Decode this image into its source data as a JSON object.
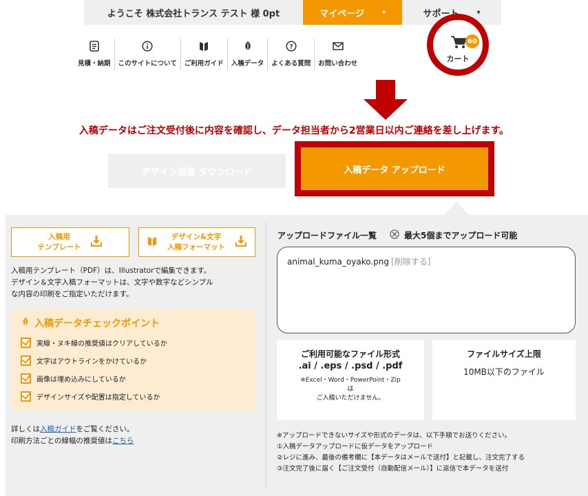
{
  "topbar": {
    "welcome": "ようこそ 株式会社トランス テスト 様 0pt",
    "mypage": "マイページ",
    "support": "サポート"
  },
  "nav": [
    {
      "label": "見積・納期",
      "icon": "document-icon"
    },
    {
      "label": "このサイトについて",
      "icon": "info-icon"
    },
    {
      "label": "ご利用ガイド",
      "icon": "book-icon"
    },
    {
      "label": "入稿データ",
      "icon": "leaf-icon"
    },
    {
      "label": "よくある質問",
      "icon": "question-icon"
    },
    {
      "label": "お問い合わせ",
      "icon": "mail-icon"
    }
  ],
  "cart": {
    "label": "カート",
    "count": "60"
  },
  "notice": "入稿データはご注文受付後に内容を確認し、データ担当者から2営業日以内ご連絡を差し上げます。",
  "buttons": {
    "download": "デザイン画像 ダウンロード",
    "upload": "入稿データ アップロード"
  },
  "left": {
    "template_btn_line1": "入稿用",
    "template_btn_line2": "テンプレート",
    "format_btn_line1": "デザイン&文字",
    "format_btn_line2": "入稿フォーマット",
    "desc_line1": "入稿用テンプレート（PDF）は、Illustratorで編集できます。",
    "desc_line2": "デザイン＆文字入稿フォーマットは、文字や数字などシンプル",
    "desc_line3": "な内容の印刷をご指定いただけます。",
    "check_title": "入稿データチェックポイント",
    "checks": [
      "実線・ヌキ線の推奨値はクリアしているか",
      "文字はアウトラインをかけているか",
      "画像は埋め込みにしているか",
      "デザインサイズや配置は指定しているか"
    ],
    "foot1_pre": "詳しくは",
    "foot1_link": "入稿ガイド",
    "foot1_post": "をご覧ください。",
    "foot2_pre": "印刷方法ごとの線幅の推奨値は",
    "foot2_link": "こちら"
  },
  "right": {
    "list_title": "アップロードファイル一覧",
    "max_text": "最大5個までアップロード可能",
    "file_name": "animal_kuma_oyako.png",
    "file_delete": "[削除する]",
    "formats_title": "ご利用可能なファイル形式",
    "formats": ".ai / .eps / .psd / .pdf",
    "formats_note1": "※Excel・Word・PowerPoint・Zip",
    "formats_note2": "は",
    "formats_note3": "ご入稿いただけません。",
    "size_title": "ファイルサイズ上限",
    "size_value": "10MB以下のファイル",
    "notes": [
      "※アップロードできないサイズや形式のデータは、以下手順でお送りください。",
      "①入稿データアップロードに仮データをアップロード",
      "②レジに進み、最後の備考欄に【本データはメールで送付】と記載し、注文完了する",
      "③注文完了後に届く【ご注文受付（自動配信メール）】に返信で本データを送付"
    ]
  },
  "colors": {
    "accent": "#f39800",
    "alert": "#c00000",
    "panel": "#efefef"
  }
}
